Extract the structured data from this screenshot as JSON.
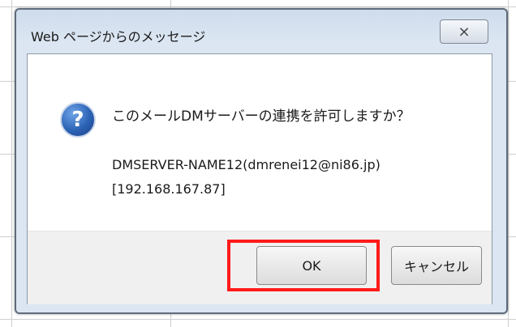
{
  "dialog": {
    "title": "Web ページからのメッセージ",
    "close_label": "⨯",
    "message": "このメールDMサーバーの連携を許可しますか？",
    "detail_line1": "DMSERVER-NAME12(dmrenei12@ni86.jp)",
    "detail_line2": "[192.168.167.87]",
    "ok_label": "OK",
    "cancel_label": "キャンセル",
    "icon": "question-icon",
    "icon_glyph": "?"
  },
  "colors": {
    "highlight": "#ff1a1a",
    "dialog_frame": "#dbe6f2",
    "icon_blue": "#2c63b5"
  }
}
